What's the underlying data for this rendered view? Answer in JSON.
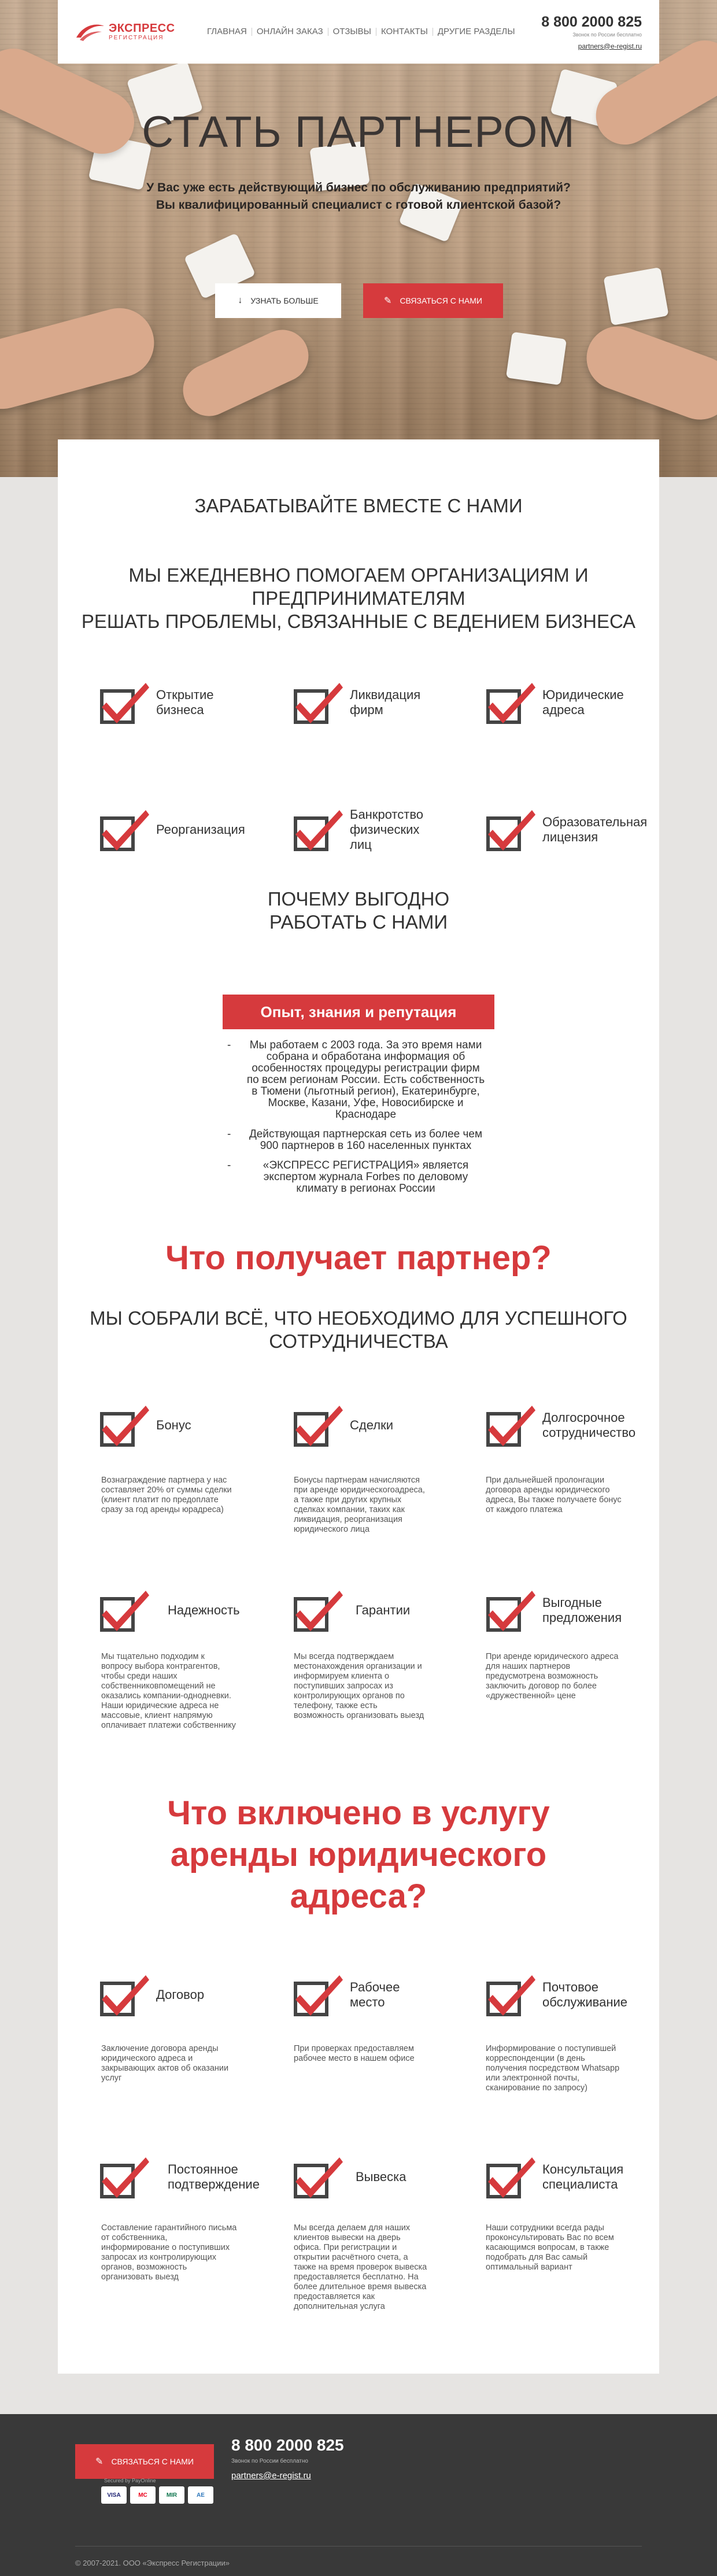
{
  "header": {
    "logo_main": "ЭКСПРЕСС",
    "logo_sub": "РЕГИСТРАЦИЯ",
    "nav": [
      "ГЛАВНАЯ",
      "ОНЛАЙН ЗАКАЗ",
      "ОТЗЫВЫ",
      "КОНТАКТЫ",
      "ДРУГИЕ РАЗДЕЛЫ"
    ],
    "phone": "8 800 2000 825",
    "phone_sub": "Звонок по России бесплатно",
    "email": "partners@e-regist.ru"
  },
  "hero": {
    "title": "СТАТЬ ПАРТНЕРОМ",
    "subtitle_1": "У Вас уже есть действующий бизнес по обслуживанию предприятий?",
    "subtitle_2": "Вы квалифицированный специалист с готовой клиентской базой?",
    "btn_more": "УЗНАТЬ БОЛЬШЕ",
    "btn_contact": "СВЯЗАТЬСЯ С НАМИ"
  },
  "earn": {
    "title": "ЗАРАБАТЫВАЙТЕ ВМЕСТЕ С НАМИ",
    "help_1": "МЫ ЕЖЕДНЕВНО ПОМОГАЕМ ОРГАНИЗАЦИЯМ И",
    "help_2": "ПРЕДПРИНИМАТЕЛЯМ",
    "help_3": "РЕШАТЬ ПРОБЛЕМЫ, СВЯЗАННЫЕ С ВЕДЕНИЕМ БИЗНЕСА",
    "services": [
      "Открытие бизнеса",
      "Ликвидация фирм",
      "Юридические адреса",
      "Реорганизация",
      "Банкротство физических лиц",
      "Образовательная лицензия"
    ]
  },
  "why": {
    "title_1": "ПОЧЕМУ ВЫГОДНО",
    "title_2": "РАБОТАТЬ С НАМИ",
    "badge": "Опыт, знания и репутация",
    "bullets": [
      "Мы работаем с 2003 года. За это время нами собрана и обработана информация об особенностях процедуры регистрации фирм по всем регионам России. Есть собственность в Тюмени (льготный регион), Екатеринбурге, Москве, Казани, Уфе, Новосибирске и Краснодаре",
      "Действующая партнерская сеть из более чем 900 партнеров в 160 населенных пунктах",
      "«ЭКСПРЕСС РЕГИСТРАЦИЯ» является экспертом журнала Forbes по деловому климату в регионах России"
    ]
  },
  "gets": {
    "title": "Что получает партнер?",
    "sub_1": "МЫ СОБРАЛИ ВСЁ, ЧТО НЕОБХОДИМО ДЛЯ УСПЕШНОГО",
    "sub_2": "СОТРУДНИЧЕСТВА",
    "items": [
      {
        "label": "Бонус",
        "desc": "Вознаграждение партнера у нас составляет 20% от суммы сделки (клиент платит по предоплате сразу за год аренды юрадреса)"
      },
      {
        "label": "Сделки",
        "desc": "Бонусы партнерам начисляются при аренде юридическогоадреса, а также при других крупных сделках компании, таких как ликвидация, реорганизация юридического лица"
      },
      {
        "label": "Долгосрочное сотрудничество",
        "desc": "При дальнейшей пролонгации договора аренды юридического адреса, Вы также получаете бонус от каждого платежа"
      },
      {
        "label": "Надежность",
        "desc": "Мы тщательно подходим к вопросу выбора контрагентов, чтобы среди наших собственниковпомещений не оказались компании-однодневки. Наши юридические адреса не массовые, клиент напрямую оплачивает платежи собственнику"
      },
      {
        "label": "Гарантии",
        "desc": "Мы всегда подтверждаем местонахождения организации и информируем клиента о поступивших запросах из контролирующих органов по телефону, также есть возможность организовать выезд"
      },
      {
        "label": "Выгодные предложения",
        "desc": "При аренде юридического адреса для наших партнеров предусмотрена возможность заключить договор по более «дружественной» цене"
      }
    ]
  },
  "service": {
    "title_1": "Что включено в услугу",
    "title_2": "аренды юридического",
    "title_3": "адреса?",
    "items": [
      {
        "label": "Договор",
        "desc": "Заключение договора аренды юридического адреса и закрывающих актов об оказании услуг"
      },
      {
        "label": "Рабочее место",
        "desc": "При проверках предоставляем рабочее место в нашем офисе"
      },
      {
        "label": "Почтовое обслуживание",
        "desc": "Информирование о поступившей корреспонденции (в день получения посредством Whatsapp или электронной почты, сканирование по запросу)"
      },
      {
        "label": "Постоянное подтверждение",
        "desc": "Составление гарантийного письма от собственника, информирование о поступивших запросах из контролирующих органов, возможность организовать выезд"
      },
      {
        "label": "Вывеска",
        "desc": "Мы всегда делаем для наших клиентов вывески на дверь офиса. При регистрации и открытии расчётного счета, а также на время проверок вывеска предоставляется бесплатно. На более длительное время вывеска предоставляется как дополнительная услуга"
      },
      {
        "label": "Консультация специалиста",
        "desc": "Наши сотрудники всегда рады проконсультировать Вас по всем касающимся вопросам, в также подобрать для Вас самый оптимальный вариант"
      }
    ]
  },
  "footer": {
    "btn_contact": "СВЯЗАТЬСЯ С НАМИ",
    "phone": "8 800 2000 825",
    "phone_sub": "Звонок по России бесплатно",
    "email": "partners@e-regist.ru",
    "secure": "Secured by PayOnline",
    "cards": [
      "VISA",
      "MC",
      "MIR",
      "AE"
    ],
    "copyright": "© 2007-2021. ООО «Экспресс Регистрации»"
  },
  "colors": {
    "accent": "#d63a3d",
    "footer_bg": "#393939"
  }
}
